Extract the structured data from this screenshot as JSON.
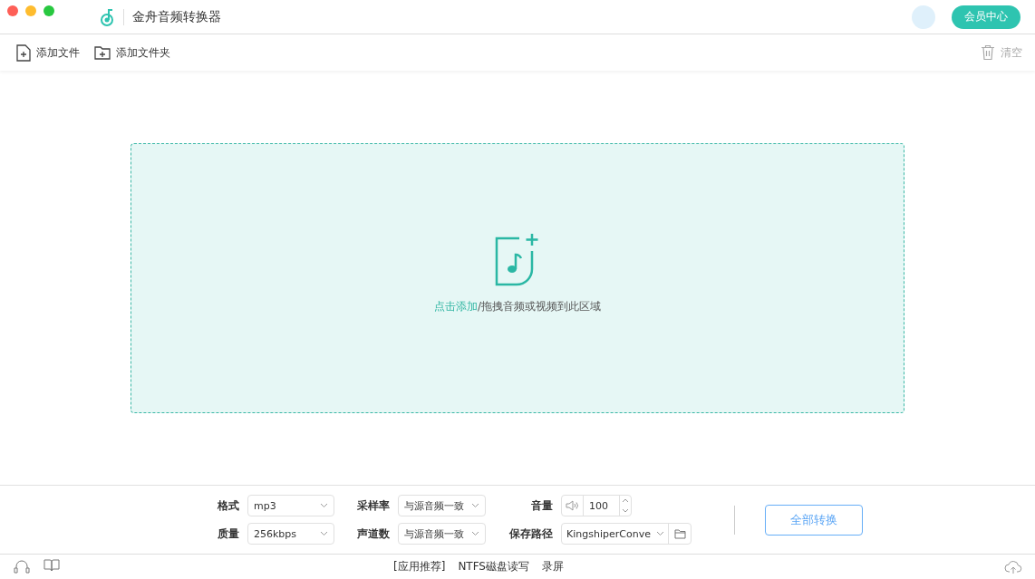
{
  "window": {
    "title": "金舟音频转换器"
  },
  "member_button": "会员中心",
  "toolbar": {
    "buttons": [
      {
        "label": "添加文件",
        "kind": "file"
      },
      {
        "label": "添加文件夹",
        "kind": "folder"
      }
    ],
    "clear": {
      "label": "清空",
      "disabled": true
    }
  },
  "dropzone": {
    "link": "点击添加",
    "text": "/拖拽音频或视频到此区域"
  },
  "settings": [
    {
      "label": "格式",
      "kind": "select",
      "value": "mp3"
    },
    {
      "label": "采样率",
      "kind": "select",
      "value": "与源音频一致"
    },
    {
      "label": "音量",
      "kind": "volume",
      "value": "100"
    },
    {
      "label": "质量",
      "kind": "select",
      "value": "256kbps"
    },
    {
      "label": "声道数",
      "kind": "select",
      "value": "与源音频一致"
    },
    {
      "label": "保存路径",
      "kind": "path",
      "value": "KingshiperConve"
    }
  ],
  "convert_button": "全部转换",
  "footer_links": [
    "[应用推荐]",
    "NTFS磁盘读写",
    "录屏"
  ]
}
